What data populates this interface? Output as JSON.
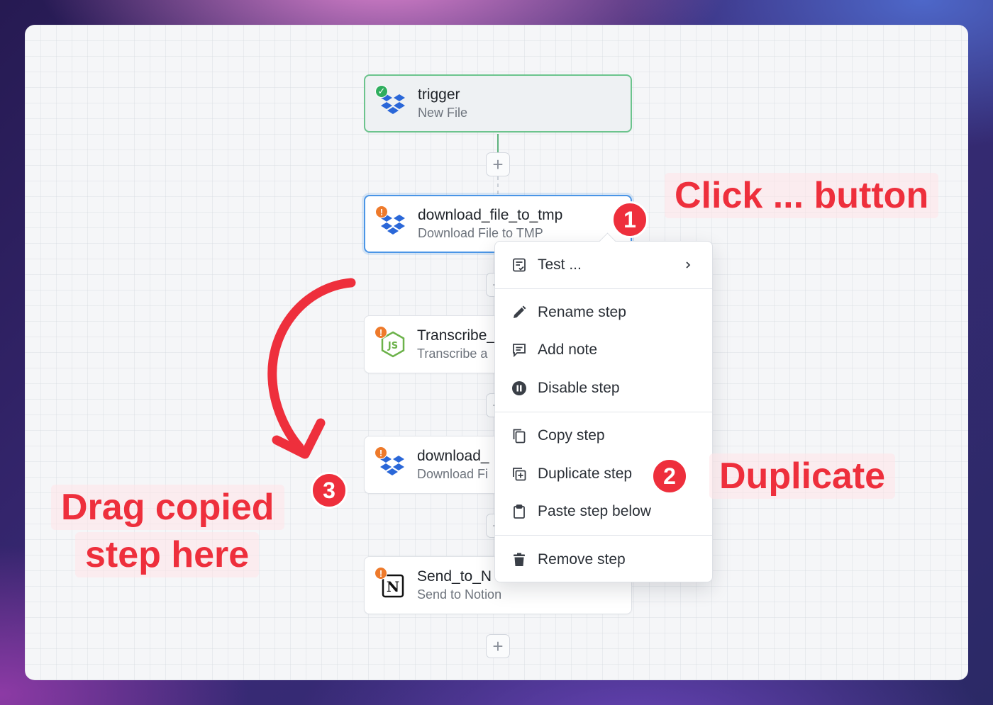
{
  "workflow": {
    "steps": [
      {
        "name": "trigger",
        "subtitle": "New File",
        "status": "success",
        "app_icon": "dropbox-icon"
      },
      {
        "name": "download_file_to_tmp",
        "subtitle": "Download File to TMP",
        "status": "warning",
        "app_icon": "dropbox-icon"
      },
      {
        "name": "Transcribe_",
        "subtitle": "Transcribe a",
        "status": "warning",
        "app_icon": "nodejs-icon"
      },
      {
        "name": "download_",
        "subtitle": "Download Fi",
        "status": "warning",
        "app_icon": "dropbox-icon"
      },
      {
        "name": "Send_to_N",
        "subtitle": "Send to Notion",
        "status": "warning",
        "app_icon": "notion-icon"
      }
    ],
    "add_button_label": "+"
  },
  "context_menu": {
    "items": [
      {
        "label": "Test ...",
        "icon": "test-icon",
        "has_submenu": true
      },
      {
        "label": "Rename step",
        "icon": "pencil-icon"
      },
      {
        "label": "Add note",
        "icon": "note-icon"
      },
      {
        "label": "Disable step",
        "icon": "pause-icon"
      },
      {
        "label": "Copy step",
        "icon": "copy-icon"
      },
      {
        "label": "Duplicate step",
        "icon": "duplicate-icon"
      },
      {
        "label": "Paste step below",
        "icon": "clipboard-icon"
      },
      {
        "label": "Remove step",
        "icon": "trash-icon"
      }
    ]
  },
  "annotations": {
    "callout_1": "Click ... button",
    "callout_2": "Duplicate",
    "callout_3_line1": "Drag copied",
    "callout_3_line2": "step here",
    "badge_1": "1",
    "badge_2": "2",
    "badge_3": "3"
  },
  "colors": {
    "accent_red": "#ee2f3c",
    "trigger_border": "#6cc48d",
    "selected_border": "#4a95e6",
    "warning": "#ee7a2b",
    "success": "#2fae5e"
  }
}
